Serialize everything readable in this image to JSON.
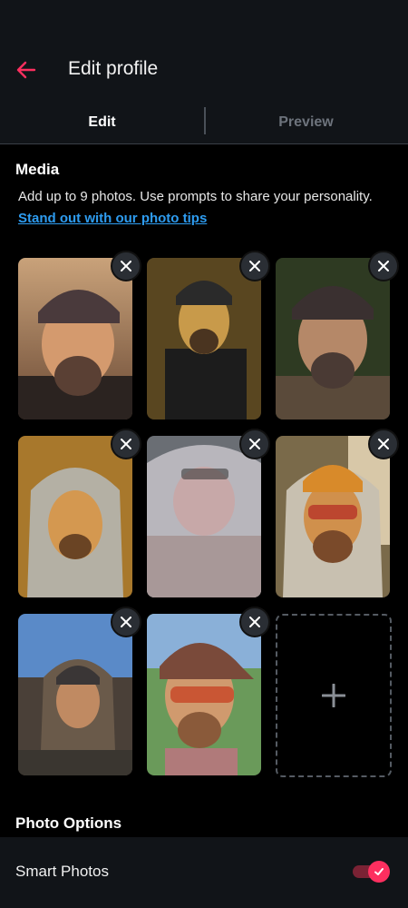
{
  "header": {
    "title": "Edit profile",
    "back_icon": "back-arrow-icon",
    "accent_color": "#fd2f5f"
  },
  "tabs": [
    {
      "label": "Edit",
      "active": true
    },
    {
      "label": "Preview",
      "active": false
    }
  ],
  "media": {
    "title": "Media",
    "description": "Add up to 9 photos. Use prompts to share your personality.",
    "tips_link": "Stand out with our photo tips",
    "photos_count": 8,
    "max_photos": 9
  },
  "photo_options": {
    "title": "Photo Options",
    "smart_photos_label": "Smart Photos",
    "smart_photos_enabled": true
  }
}
